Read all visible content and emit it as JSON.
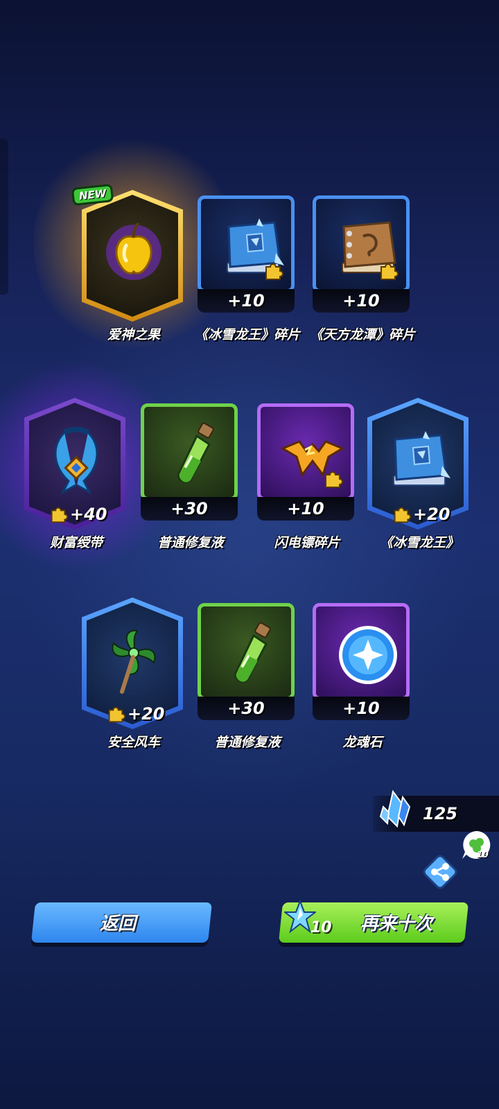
{
  "rows": [
    [
      {
        "name": "爱神之果",
        "qty": "",
        "badge": "NEW",
        "frame": "hex",
        "color": "gold",
        "icon": "golden-apple-icon",
        "glow": "gold"
      },
      {
        "name": "《冰雪龙王》碎片",
        "qty": "+10",
        "frame": "card",
        "color": "blue",
        "icon": "ice-dragon-book-icon",
        "puzzle": true
      },
      {
        "name": "《天方龙潭》碎片",
        "qty": "+10",
        "frame": "card",
        "color": "blue",
        "icon": "leather-dragon-book-icon",
        "puzzle": true
      }
    ],
    [
      {
        "name": "财富绶带",
        "qty": "+40",
        "frame": "hex",
        "color": "purple",
        "icon": "wealth-ribbon-icon",
        "glow": "purple",
        "puzzle": true
      },
      {
        "name": "普通修复液",
        "qty": "+30",
        "frame": "card",
        "color": "green",
        "icon": "green-potion-icon"
      },
      {
        "name": "闪电镖碎片",
        "qty": "+10",
        "frame": "card",
        "color": "purple",
        "icon": "lightning-dart-icon",
        "puzzle": true
      },
      {
        "name": "《冰雪龙王》",
        "qty": "+20",
        "frame": "hex",
        "color": "blue",
        "icon": "ice-dragon-book-icon",
        "puzzle": true
      }
    ],
    [
      {
        "name": "安全风车",
        "qty": "+20",
        "frame": "hex",
        "color": "blue",
        "icon": "pinwheel-icon",
        "puzzle": true
      },
      {
        "name": "普通修复液",
        "qty": "+30",
        "frame": "card",
        "color": "green",
        "icon": "green-potion-icon"
      },
      {
        "name": "龙魂石",
        "qty": "+10",
        "frame": "card",
        "color": "purple",
        "icon": "dragon-soul-orb-icon"
      }
    ]
  ],
  "currency": {
    "value": "125",
    "icon": "blue-crystal-icon"
  },
  "bubble": {
    "value": "10",
    "icon": "clover-icon"
  },
  "share": {
    "icon": "share-icon"
  },
  "buttons": {
    "back": {
      "label": "返回"
    },
    "again": {
      "label": "再来十次",
      "cost": "10",
      "cost_icon": "crystal-star-icon"
    }
  }
}
